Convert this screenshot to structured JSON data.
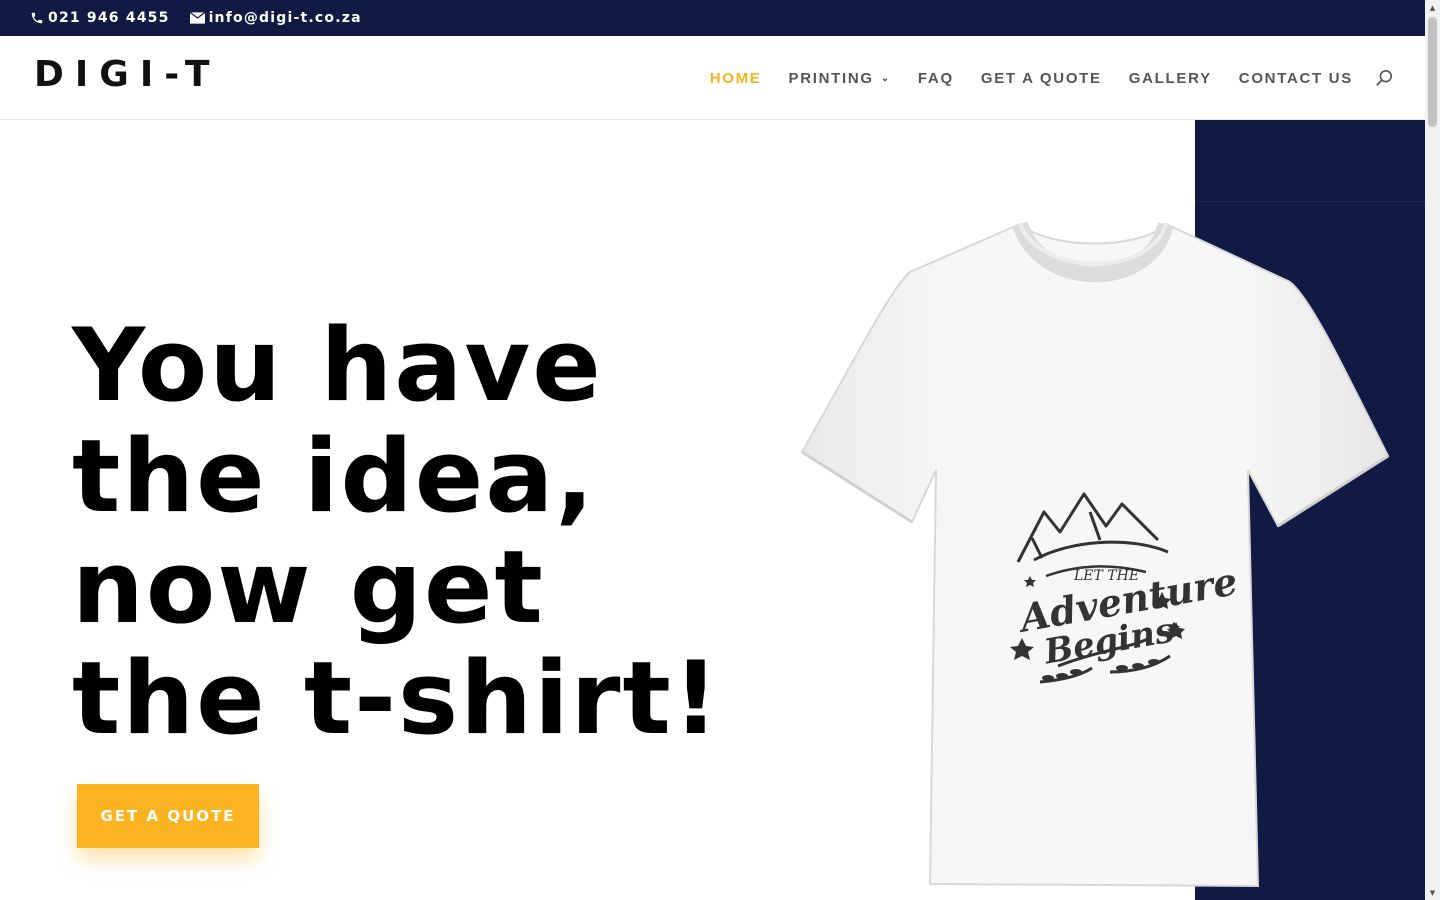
{
  "topbar": {
    "phone": "021 946 4455",
    "email": "info@digi-t.co.za",
    "phone_icon": "phone-icon",
    "email_icon": "envelope-icon"
  },
  "header": {
    "logo": "DIGI-T",
    "nav": [
      {
        "label": "Home",
        "active": true
      },
      {
        "label": "Printing",
        "has_submenu": true
      },
      {
        "label": "FAQ"
      },
      {
        "label": "Get A Quote"
      },
      {
        "label": "Gallery"
      },
      {
        "label": "Contact Us"
      }
    ],
    "search_icon": "search-icon"
  },
  "hero": {
    "headline_lines": [
      "You have",
      "the idea,",
      "now get",
      "the t-shirt!"
    ],
    "cta_label": "Get A Quote",
    "tshirt_print": {
      "line1": "LET THE",
      "line2": "Adventure",
      "line3": "Begins"
    }
  },
  "colors": {
    "navy": "#101a43",
    "accent": "#fbb321",
    "nav_active": "#f4b41a",
    "nav_text": "#555555"
  }
}
